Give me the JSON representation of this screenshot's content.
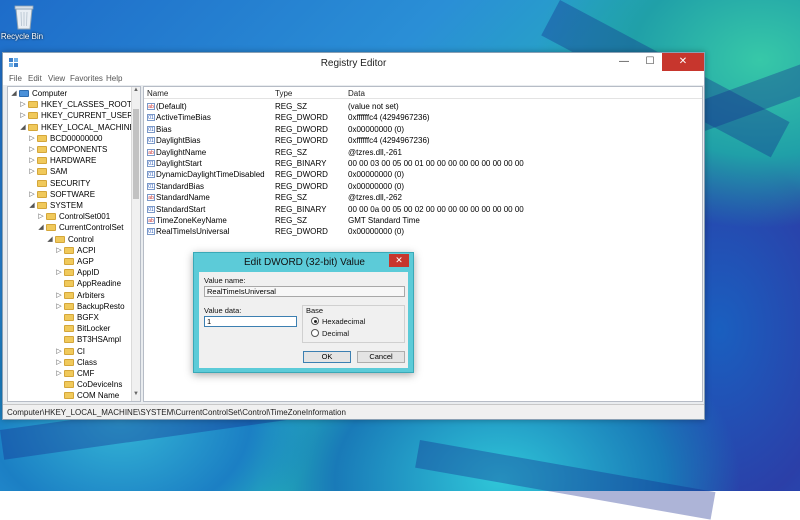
{
  "desktop": {
    "recycle_bin_label": "Recycle Bin"
  },
  "window": {
    "title": "Registry Editor",
    "controls": {
      "minimize": "—",
      "maximize": "☐",
      "close": "✕"
    }
  },
  "menu": [
    "File",
    "Edit",
    "View",
    "Favorites",
    "Help"
  ],
  "tree": [
    {
      "label": "Computer",
      "arrow": "◢",
      "depth": 0,
      "icon": "computer-icon"
    },
    {
      "label": "HKEY_CLASSES_ROOT",
      "arrow": "▷",
      "depth": 1
    },
    {
      "label": "HKEY_CURRENT_USER",
      "arrow": "▷",
      "depth": 1
    },
    {
      "label": "HKEY_LOCAL_MACHINE",
      "arrow": "◢",
      "depth": 1
    },
    {
      "label": "BCD00000000",
      "arrow": "▷",
      "depth": 2
    },
    {
      "label": "COMPONENTS",
      "arrow": "▷",
      "depth": 2
    },
    {
      "label": "HARDWARE",
      "arrow": "▷",
      "depth": 2
    },
    {
      "label": "SAM",
      "arrow": "▷",
      "depth": 2
    },
    {
      "label": "SECURITY",
      "arrow": "",
      "depth": 2
    },
    {
      "label": "SOFTWARE",
      "arrow": "▷",
      "depth": 2
    },
    {
      "label": "SYSTEM",
      "arrow": "◢",
      "depth": 2
    },
    {
      "label": "ControlSet001",
      "arrow": "▷",
      "depth": 3
    },
    {
      "label": "CurrentControlSet",
      "arrow": "◢",
      "depth": 3
    },
    {
      "label": "Control",
      "arrow": "◢",
      "depth": 4
    },
    {
      "label": "ACPI",
      "arrow": "▷",
      "depth": 5
    },
    {
      "label": "AGP",
      "arrow": "",
      "depth": 5
    },
    {
      "label": "AppID",
      "arrow": "▷",
      "depth": 5
    },
    {
      "label": "AppReadine",
      "arrow": "",
      "depth": 5
    },
    {
      "label": "Arbiters",
      "arrow": "▷",
      "depth": 5
    },
    {
      "label": "BackupResto",
      "arrow": "▷",
      "depth": 5
    },
    {
      "label": "BGFX",
      "arrow": "",
      "depth": 5
    },
    {
      "label": "BitLocker",
      "arrow": "",
      "depth": 5
    },
    {
      "label": "BT3HSAmpl",
      "arrow": "",
      "depth": 5
    },
    {
      "label": "CI",
      "arrow": "▷",
      "depth": 5
    },
    {
      "label": "Class",
      "arrow": "▷",
      "depth": 5
    },
    {
      "label": "CMF",
      "arrow": "▷",
      "depth": 5
    },
    {
      "label": "CoDeviceIns",
      "arrow": "",
      "depth": 5
    },
    {
      "label": "COM Name",
      "arrow": "",
      "depth": 5
    }
  ],
  "list": {
    "headers": [
      "Name",
      "Type",
      "Data"
    ],
    "rows": [
      {
        "icon": "ab",
        "name": "(Default)",
        "type": "REG_SZ",
        "data": "(value not set)"
      },
      {
        "icon": "dw",
        "name": "ActiveTimeBias",
        "type": "REG_DWORD",
        "data": "0xffffffc4 (4294967236)"
      },
      {
        "icon": "dw",
        "name": "Bias",
        "type": "REG_DWORD",
        "data": "0x00000000 (0)"
      },
      {
        "icon": "dw",
        "name": "DaylightBias",
        "type": "REG_DWORD",
        "data": "0xffffffc4 (4294967236)"
      },
      {
        "icon": "ab",
        "name": "DaylightName",
        "type": "REG_SZ",
        "data": "@tzres.dll,-261"
      },
      {
        "icon": "dw",
        "name": "DaylightStart",
        "type": "REG_BINARY",
        "data": "00 00 03 00 05 00 01 00 00 00 00 00 00 00 00 00"
      },
      {
        "icon": "dw",
        "name": "DynamicDaylightTimeDisabled",
        "type": "REG_DWORD",
        "data": "0x00000000 (0)"
      },
      {
        "icon": "dw",
        "name": "StandardBias",
        "type": "REG_DWORD",
        "data": "0x00000000 (0)"
      },
      {
        "icon": "ab",
        "name": "StandardName",
        "type": "REG_SZ",
        "data": "@tzres.dll,-262"
      },
      {
        "icon": "dw",
        "name": "StandardStart",
        "type": "REG_BINARY",
        "data": "00 00 0a 00 05 00 02 00 00 00 00 00 00 00 00 00"
      },
      {
        "icon": "ab",
        "name": "TimeZoneKeyName",
        "type": "REG_SZ",
        "data": "GMT Standard Time"
      },
      {
        "icon": "dw",
        "name": "RealTimeIsUniversal",
        "type": "REG_DWORD",
        "data": "0x00000000 (0)"
      }
    ]
  },
  "status": "Computer\\HKEY_LOCAL_MACHINE\\SYSTEM\\CurrentControlSet\\Control\\TimeZoneInformation",
  "dialog": {
    "title": "Edit DWORD (32-bit) Value",
    "close": "✕",
    "value_name_label": "Value name:",
    "value_name": "RealTimeIsUniversal",
    "value_data_label": "Value data:",
    "value_data": "1",
    "base_label": "Base",
    "hex_label": "Hexadecimal",
    "dec_label": "Decimal",
    "ok": "OK",
    "cancel": "Cancel"
  }
}
